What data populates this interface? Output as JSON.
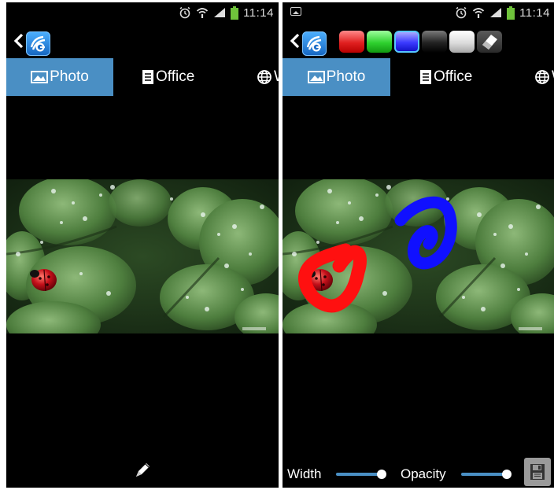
{
  "status": {
    "time": "11:14"
  },
  "tabs": {
    "photo": "Photo",
    "office": "Office",
    "web_partial": "W"
  },
  "drawing_toolbar": {
    "colors": [
      "#e02020",
      "#2fd12f",
      "#3a3aff",
      "#222222",
      "#e6e6e6"
    ],
    "selected_color": "#3a3aff",
    "eraser": "eraser-icon"
  },
  "bottom_controls": {
    "width_label": "Width",
    "opacity_label": "Opacity",
    "width_value": 1.0,
    "opacity_value": 1.0
  },
  "icons": [
    "back-arrow-icon",
    "app-logo-icon",
    "photo-icon",
    "document-icon",
    "globe-icon",
    "pencil-icon",
    "save-icon",
    "alarm-icon",
    "wifi-icon",
    "signal-icon",
    "battery-icon",
    "image-notification-icon"
  ],
  "colors": {
    "active_tab": "#4a8fc4",
    "stroke_red": "#ff1010",
    "stroke_blue": "#1010ff"
  }
}
